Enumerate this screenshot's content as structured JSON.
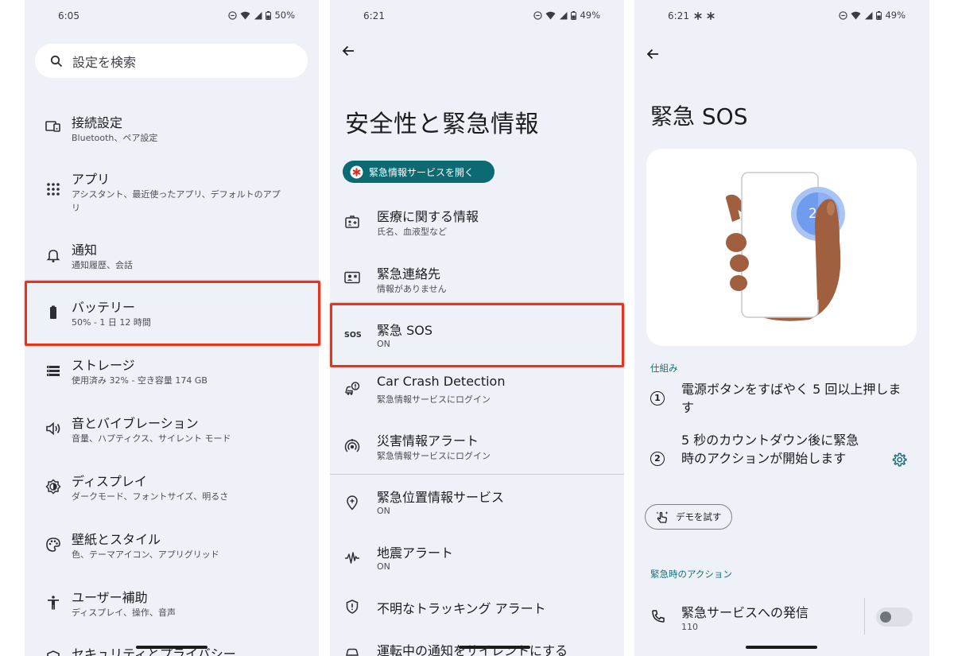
{
  "panel1": {
    "status": {
      "time": "6:05",
      "battery": "50%"
    },
    "search_placeholder": "設定を検索",
    "items": [
      {
        "title": "接続設定",
        "subtitle": "Bluetooth、ペア設定",
        "icon": "devices-icon"
      },
      {
        "title": "アプリ",
        "subtitle": "アシスタント、最近使ったアプリ、デフォルトのアプリ",
        "icon": "apps-grid-icon"
      },
      {
        "title": "通知",
        "subtitle": "通知履歴、会話",
        "icon": "bell-icon"
      },
      {
        "title": "バッテリー",
        "subtitle": "50% - 1 日 12 時間",
        "icon": "battery-icon"
      },
      {
        "title": "ストレージ",
        "subtitle": "使用済み 32% - 空き容量 174 GB",
        "icon": "storage-icon"
      },
      {
        "title": "音とバイブレーション",
        "subtitle": "音量、ハプティクス、サイレント モード",
        "icon": "volume-icon"
      },
      {
        "title": "ディスプレイ",
        "subtitle": "ダークモード、フォントサイズ、明るさ",
        "icon": "brightness-icon"
      },
      {
        "title": "壁紙とスタイル",
        "subtitle": "色、テーマアイコン、アプリグリッド",
        "icon": "palette-icon"
      },
      {
        "title": "ユーザー補助",
        "subtitle": "ディスプレイ、操作、音声",
        "icon": "accessibility-icon"
      },
      {
        "title": "セキュリティとプライバシー",
        "subtitle": "",
        "icon": "shield-icon"
      }
    ]
  },
  "panel2": {
    "status": {
      "time": "6:21",
      "battery": "49%"
    },
    "title": "安全性と緊急情報",
    "chip_label": "緊急情報サービスを開く",
    "items": [
      {
        "title": "医療に関する情報",
        "subtitle": "氏名、血液型など",
        "icon": "medical-id-icon"
      },
      {
        "title": "緊急連絡先",
        "subtitle": "情報がありません",
        "icon": "contact-card-icon"
      },
      {
        "title": "緊急 SOS",
        "subtitle": "ON",
        "icon": "sos-icon"
      },
      {
        "title": "Car Crash Detection",
        "subtitle": "緊急情報サービスにログイン",
        "icon": "car-crash-icon"
      },
      {
        "title": "災害情報アラート",
        "subtitle": "緊急情報サービスにログイン",
        "icon": "alert-signal-icon"
      },
      {
        "title": "緊急位置情報サービス",
        "subtitle": "ON",
        "icon": "location-icon"
      },
      {
        "title": "地震アラート",
        "subtitle": "ON",
        "icon": "seismic-icon"
      },
      {
        "title": "不明なトラッキング アラート",
        "subtitle": "",
        "icon": "tracker-shield-icon"
      },
      {
        "title": "運転中の通知をサイレントにする",
        "subtitle": "",
        "icon": "driving-icon"
      }
    ]
  },
  "panel3": {
    "status": {
      "time": "6:21",
      "battery": "49%"
    },
    "title": "緊急 SOS",
    "countdown_number": "2",
    "how_it_works_label": "仕組み",
    "steps": [
      {
        "num": "1",
        "text": "電源ボタンをすばやく 5 回以上押します"
      },
      {
        "num": "2",
        "text": "5 秒のカウントダウン後に緊急時のアクションが開始します"
      }
    ],
    "demo_label": "デモを試す",
    "actions_label": "緊急時のアクション",
    "call_title": "緊急サービスへの発信",
    "call_number": "110",
    "call_toggle_on": false
  },
  "colors": {
    "highlight": "#e5361d",
    "teal_chip": "#0b6a72",
    "accent_text": "#1b6e76",
    "panel_bg": "#eef2f8"
  }
}
